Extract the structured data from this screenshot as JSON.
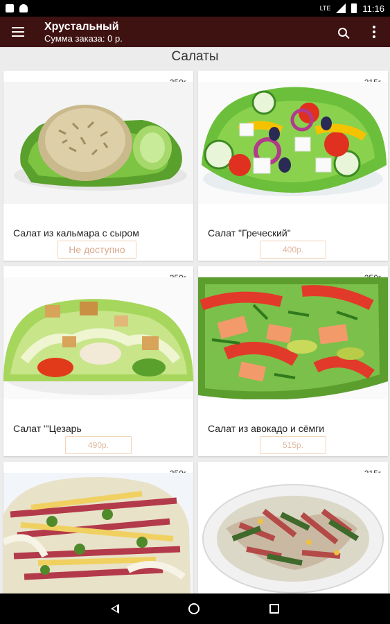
{
  "status_bar": {
    "time": "11:16",
    "network": "LTE"
  },
  "app_bar": {
    "title": "Хрустальный",
    "subtitle": "Сумма заказа: 0 р."
  },
  "section_title": "Салаты",
  "items": [
    {
      "name": "Салат из кальмара с сыром",
      "weight": "250г.",
      "price": "Не доступно",
      "available": false
    },
    {
      "name": "Салат \"Греческий\"",
      "weight": "215г.",
      "price": "400р.",
      "available": true
    },
    {
      "name": "Салат \"'Цезарь",
      "weight": "250г.",
      "price": "490р.",
      "available": true
    },
    {
      "name": "Салат из авокадо и сёмги",
      "weight": "250г.",
      "price": "515р.",
      "available": true
    },
    {
      "name": "",
      "weight": "250г.",
      "price": "",
      "available": true
    },
    {
      "name": "",
      "weight": "215г.",
      "price": "",
      "available": true
    }
  ],
  "colors": {
    "app_bar": "#3f1212",
    "price_border": "#f0d3b8",
    "price_text": "#e0b8a0"
  },
  "icons": {
    "menu": "menu-icon",
    "search": "search-icon",
    "more": "more-vert-icon",
    "back": "back-icon",
    "home": "home-icon",
    "recents": "recents-icon"
  }
}
